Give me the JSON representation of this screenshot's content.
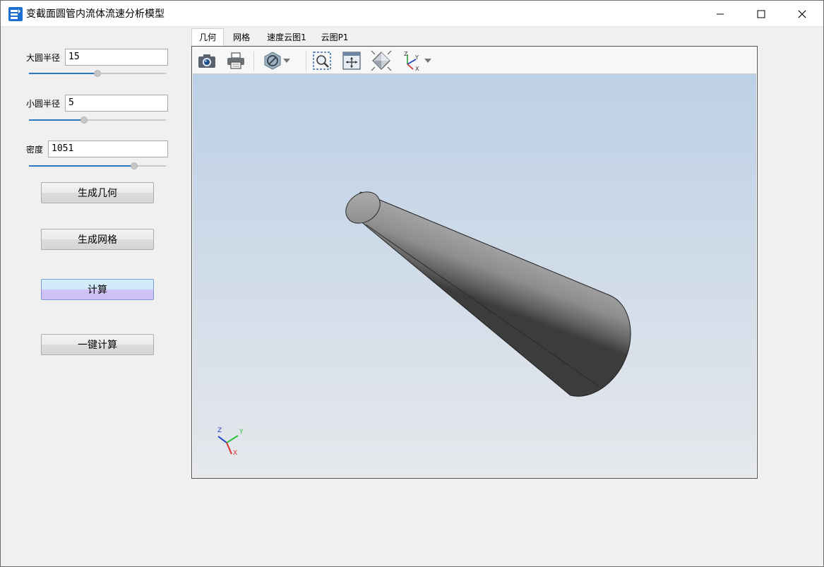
{
  "window": {
    "title": "变截面圆管内流体流速分析模型"
  },
  "params": [
    {
      "label": "大圆半径",
      "value": "15",
      "slider": 0.5
    },
    {
      "label": "小圆半径",
      "value": "5",
      "slider": 0.4
    },
    {
      "label": "密度",
      "value": "1051",
      "slider": 0.77
    }
  ],
  "actions": {
    "generate_geometry": "生成几何",
    "generate_mesh": "生成网格",
    "compute": "计算",
    "one_click_compute": "一键计算"
  },
  "tabs": [
    "几何",
    "网格",
    "速度云图1",
    "云图P1"
  ],
  "active_tab": 0,
  "toolbar_icons": [
    "camera-icon",
    "printer-icon",
    "display-mode-icon",
    "dropdown-arrow-icon",
    "zoom-region-icon",
    "fit-all-icon",
    "view-cube-icon",
    "axes-orientation-icon",
    "dropdown-arrow-icon"
  ],
  "axis_triad": {
    "x": "X",
    "y": "Y",
    "z": "Z"
  },
  "colors": {
    "slider_fill": "#2a78c4",
    "active_button_top": "#d5eefc",
    "active_button_bottom": "#ccbff3",
    "canvas_top": "#bcd0e6",
    "canvas_bottom": "#e6e8ec"
  }
}
